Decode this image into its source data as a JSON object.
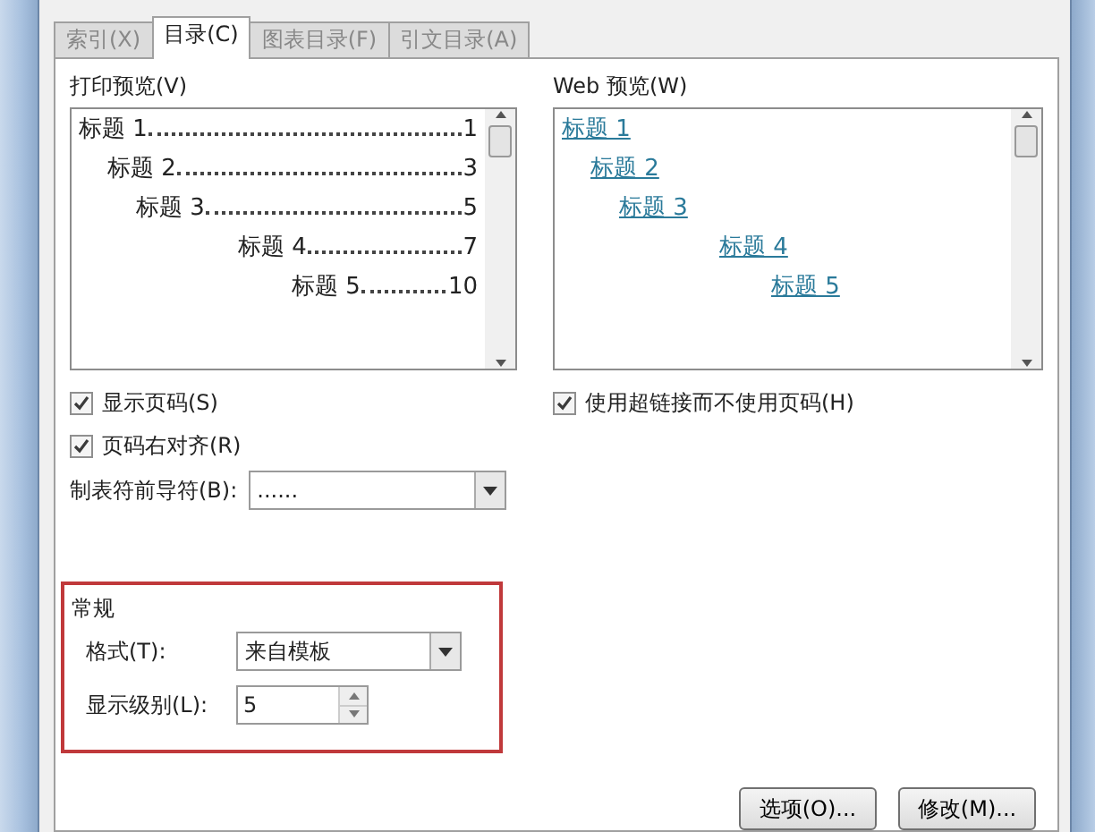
{
  "tabs": [
    {
      "label": "索引(X)",
      "selected": false
    },
    {
      "label": "目录(C)",
      "selected": true
    },
    {
      "label": "图表目录(F)",
      "selected": false
    },
    {
      "label": "引文目录(A)",
      "selected": false
    }
  ],
  "print_preview": {
    "label": "打印预览(V)",
    "entries": [
      {
        "title": "标题 1",
        "page": "1",
        "children": [
          {
            "title": "标题 2",
            "page": "3",
            "children": [
              {
                "title": "标题 3",
                "page": "5",
                "children": [
                  {
                    "title": "标题 4",
                    "page": "7",
                    "children": [
                      {
                        "title": "标题 5",
                        "page": "10"
                      }
                    ]
                  }
                ]
              }
            ]
          }
        ]
      }
    ]
  },
  "web_preview": {
    "label": "Web 预览(W)",
    "entries": [
      {
        "title": "标题 1",
        "children": [
          {
            "title": "标题 2",
            "children": [
              {
                "title": "标题 3",
                "children": [
                  {
                    "title": "标题 4",
                    "children": [
                      {
                        "title": "标题 5"
                      }
                    ]
                  }
                ]
              }
            ]
          }
        ]
      }
    ]
  },
  "options_left": [
    {
      "label": "显示页码(S)",
      "checked": true
    },
    {
      "label": "页码右对齐(R)",
      "checked": true
    }
  ],
  "options_right": [
    {
      "label": "使用超链接而不使用页码(H)",
      "checked": true
    }
  ],
  "tab_leader": {
    "label": "制表符前导符(B):",
    "value": "......"
  },
  "general": {
    "title": "常规",
    "format_label": "格式(T):",
    "format_value": "来自模板",
    "level_label": "显示级别(L):",
    "level_value": "5"
  },
  "buttons": [
    "选项(O)...",
    "修改(M)..."
  ]
}
